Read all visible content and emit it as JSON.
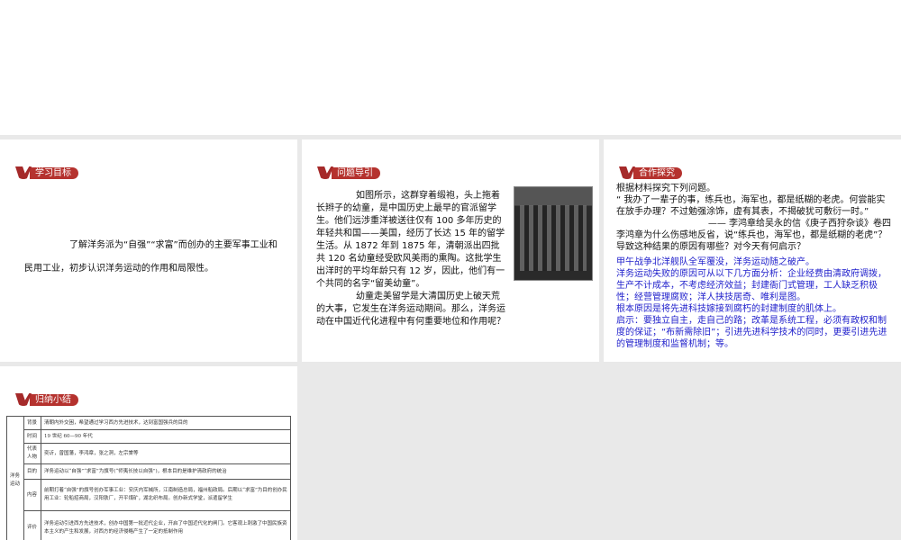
{
  "panels": {
    "goals": {
      "title": "学习目标",
      "text": "了解洋务派为“自强”“求富”而创办的主要军事工业和民用工业，初步认识洋务运动的作用和局限性。"
    },
    "intro": {
      "title": "问题导引",
      "p1": "如图所示，这群穿着缎袍，头上拖着长辫子的幼童，是中国历史上最早的官派留学生。他们远涉重洋被送往仅有 100 多年历史的年轻共和国——美国，经历了长达 15 年的留学生活。从 1872 年到 1875 年，清朝派出四批共 120 名幼童经受欧风美雨的熏陶。这批学生出洋时的平均年龄只有 12 岁，因此，他们有一个共同的名字“留美幼童”。",
      "p2": "幼童走美留学是大清国历史上破天荒的大事，它发生在洋务运动期间。那么，洋务运动在中国近代化进程中有何重要地位和作用呢？"
    },
    "explore": {
      "title": "合作探究",
      "lead": "根据材料探究下列问题。",
      "quote": "“ 我办了一辈子的事，练兵也，海军也，都是纸糊的老虎。何尝能实在放手办理？不过勉强涂饰，虚有其表，不揭破犹可敷衍一时。”",
      "source": "—— 李鸿章给吴永的信《庚子西狩杂谈》卷四",
      "question": "李鸿章为什么伤感地反省，说“练兵也，海军也，都是纸糊的老虎”？导致这种结果的原因有哪些？对今天有何启示？",
      "answers": [
        "甲午战争北洋舰队全军覆没，洋务运动随之破产。",
        "洋务运动失败的原因可从以下几方面分析：企业经费由清政府调拨，生产不计成本，不考虑经济效益；封建衙门式管理，工人缺乏积极性；经营管理腐败；洋人挟技居奇、唯利是图。",
        "根本原因是将先进科技嫁接到腐朽的封建制度的肌体上。",
        "启示：要独立自主，走自己的路；改革是系统工程，必须有政权和制度的保证；“布新需除旧”；引进先进科学技术的同时，更要引进先进的管理制度和监督机制；等。"
      ]
    },
    "summary": {
      "title": "归纳小结",
      "group": "洋务运动",
      "rows": [
        {
          "k": "背景",
          "v": "清朝内外交困，希望通过学习西方先进技术，达到富国强兵的目的"
        },
        {
          "k": "时间",
          "v": "19 世纪 60—90 年代"
        },
        {
          "k": "代表人物",
          "v": "奕䜣，曾国藩，李鸿章，张之洞，左宗棠等"
        },
        {
          "k": "目的",
          "v": "洋务运动以“自强”“求富”为旗号(“师夷长技以自强”)，根本目的是维护清政府的统治"
        },
        {
          "k": "内容",
          "v": "前期打着“自强”的旗号创办军事工业：安庆内军械所，江南制造总局，福州船政局。后期以“求富”为目的创办民用工业：轮船招商局，汉阳铁厂，开平煤矿，湖北织布局。创办新式学堂，派遣留学生"
        },
        {
          "k": "评价",
          "v": "洋务运动引进西方先进技术，创办中国第一批近代企业，开启了中国近代化的闸门。它客观上刺激了中国民族资本主义的产生和发展，对西方的经济侵略产生了一定的抵制作用"
        }
      ]
    }
  },
  "colors": {
    "badge": "#b5322e",
    "answer": "#2222cc"
  }
}
